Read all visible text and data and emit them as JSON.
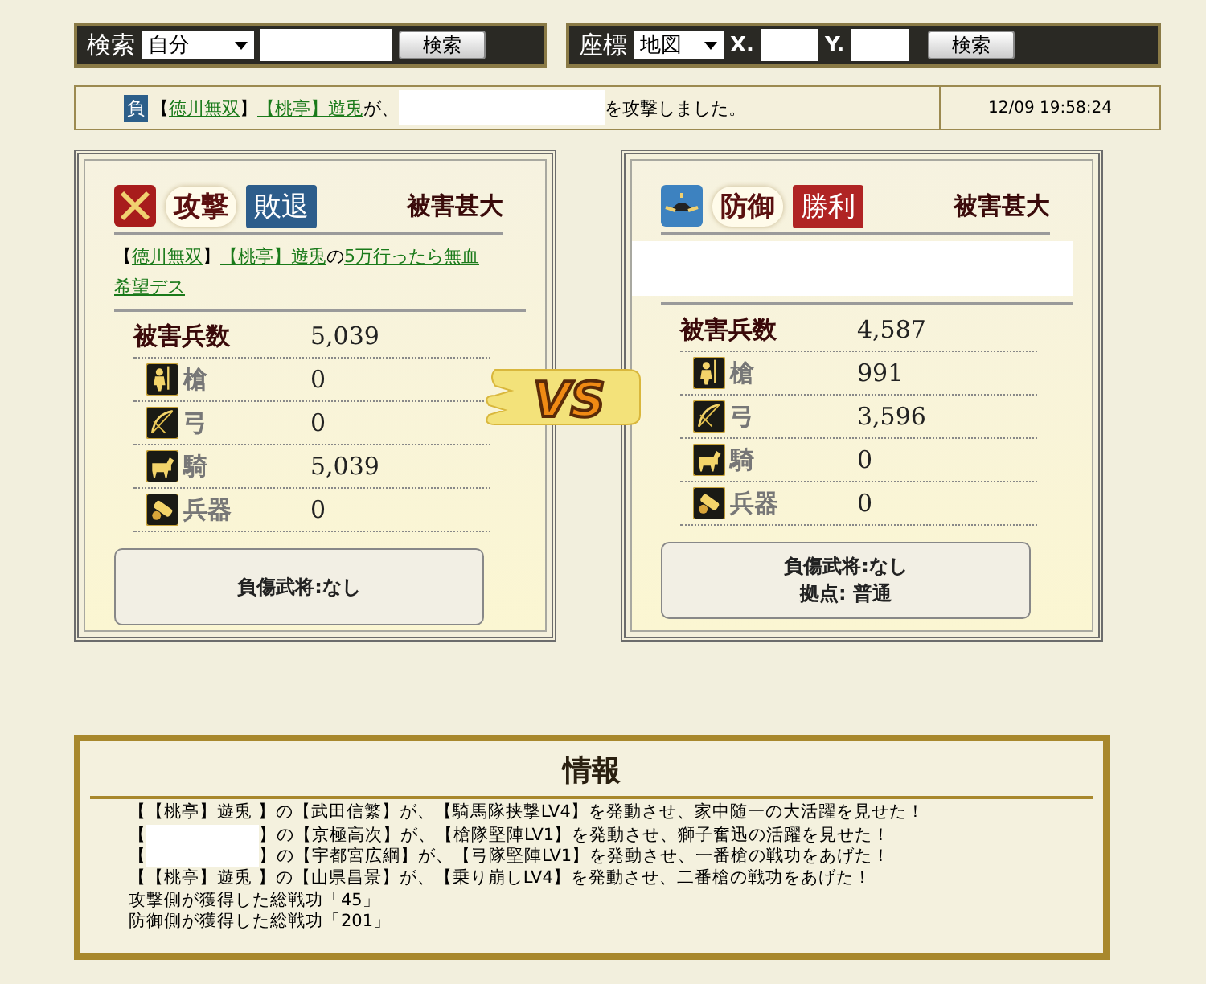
{
  "search_bar": {
    "label": "検索",
    "select": "自分",
    "button": "検索"
  },
  "coord_bar": {
    "label": "座標",
    "select": "地図",
    "x_label": "X.",
    "y_label": "Y.",
    "button": "検索"
  },
  "message": {
    "badge": "負",
    "parts": [
      {
        "kind": "text",
        "text": "【"
      },
      {
        "kind": "link",
        "text": "徳川無双"
      },
      {
        "kind": "text",
        "text": " 】"
      },
      {
        "kind": "link",
        "text": "【桃亭】遊兎"
      },
      {
        "kind": "text",
        "text": " が、"
      },
      {
        "kind": "redacted"
      },
      {
        "kind": "text",
        "text": "を攻撃しました。"
      }
    ],
    "time": "12/09 19:58:24"
  },
  "panels": [
    {
      "kind": "attack",
      "role": "攻撃",
      "result": "敗退",
      "won": false,
      "severity": "被害甚大",
      "header": [
        {
          "kind": "text",
          "text": "【"
        },
        {
          "kind": "link",
          "text": "徳川無双"
        },
        {
          "kind": "text",
          "text": " 】"
        },
        {
          "kind": "link",
          "text": "【桃亭】遊兎"
        },
        {
          "kind": "text",
          "text": " の "
        },
        {
          "kind": "link",
          "text": "5万行ったら無血"
        },
        {
          "kind": "link",
          "text": "希望デス"
        }
      ],
      "total_label": "被害兵数",
      "total": "5,039",
      "units": [
        {
          "kind": "spear",
          "label": "槍",
          "value": "0"
        },
        {
          "kind": "bow",
          "label": "弓",
          "value": "0"
        },
        {
          "kind": "cavalry",
          "label": "騎",
          "value": "5,039"
        },
        {
          "kind": "siege",
          "label": "兵器",
          "value": "0"
        }
      ],
      "footer": [
        "負傷武将:なし"
      ]
    },
    {
      "kind": "defense",
      "role": "防御",
      "result": "勝利",
      "won": true,
      "severity": "被害甚大",
      "header": [
        {
          "kind": "redacted"
        }
      ],
      "total_label": "被害兵数",
      "total": "4,587",
      "units": [
        {
          "kind": "spear",
          "label": "槍",
          "value": "991"
        },
        {
          "kind": "bow",
          "label": "弓",
          "value": "3,596"
        },
        {
          "kind": "cavalry",
          "label": "騎",
          "value": "0"
        },
        {
          "kind": "siege",
          "label": "兵器",
          "value": "0"
        }
      ],
      "footer": [
        "負傷武将:なし",
        "拠点: 普通"
      ]
    }
  ],
  "vs": "VS",
  "info": {
    "title": "情報",
    "lines": [
      [
        {
          "kind": "text",
          "text": "【【桃亭】遊兎 】の【武田信繁】が、【騎馬隊挟撃LV4】を発動させ、家中随一の大活躍を見せた！"
        }
      ],
      [
        {
          "kind": "text",
          "text": "【"
        },
        {
          "kind": "redacted"
        },
        {
          "kind": "text",
          "text": "】の【京極高次】が、【槍隊堅陣LV1】を発動させ、獅子奮迅の活躍を見せた！"
        }
      ],
      [
        {
          "kind": "text",
          "text": "【"
        },
        {
          "kind": "redacted"
        },
        {
          "kind": "text",
          "text": "】の【宇都宮広綱】が、【弓隊堅陣LV1】を発動させ、一番槍の戦功をあげた！"
        }
      ],
      [
        {
          "kind": "text",
          "text": "【【桃亭】遊兎 】の【山県昌景】が、【乗り崩しLV4】を発動させ、二番槍の戦功をあげた！"
        }
      ],
      [
        {
          "kind": "text",
          "text": "攻撃側が獲得した総戦功「45」"
        }
      ],
      [
        {
          "kind": "text",
          "text": "防御側が獲得した総戦功「201」"
        }
      ]
    ]
  }
}
